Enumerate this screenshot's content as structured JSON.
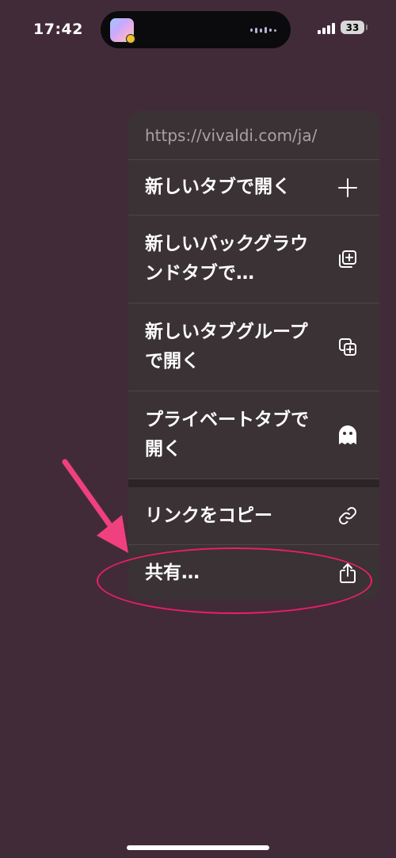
{
  "status_bar": {
    "time": "17:42",
    "battery": "33"
  },
  "menu": {
    "url": "https://vivaldi.com/ja/",
    "items": [
      {
        "label": "新しいタブで開く",
        "icon": "plus-icon"
      },
      {
        "label": "新しいバックグラウンドタブで…",
        "icon": "background-tab-icon"
      },
      {
        "label": "新しいタブグループで開く",
        "icon": "tab-group-icon"
      },
      {
        "label": "プライベートタブで開く",
        "icon": "ghost-icon"
      },
      {
        "label": "リンクをコピー",
        "icon": "link-icon"
      },
      {
        "label": "共有…",
        "icon": "share-icon"
      }
    ]
  },
  "colors": {
    "background": "#422b38",
    "menu": "#3a3234",
    "annotation": "#e91e6a"
  }
}
